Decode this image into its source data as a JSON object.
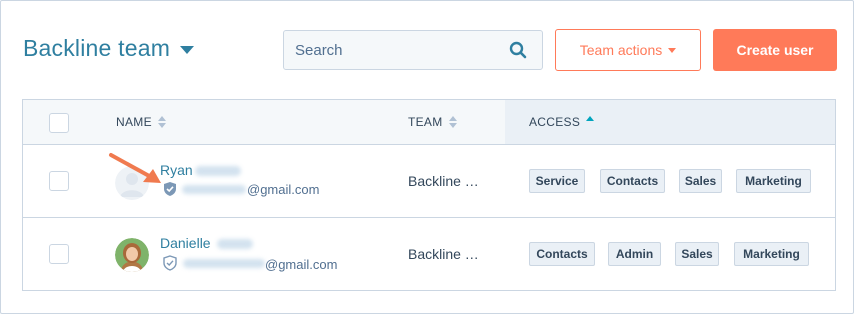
{
  "header": {
    "title": "Backline team",
    "search_placeholder": "Search",
    "team_actions_label": "Team actions",
    "create_user_label": "Create user"
  },
  "columns": {
    "name": "NAME",
    "team": "TEAM",
    "access": "ACCESS"
  },
  "users": [
    {
      "first_name": "Ryan",
      "email_suffix": "@gmail.com",
      "team": "Backline …",
      "access": [
        "Service",
        "Contacts",
        "Sales",
        "Marketing"
      ]
    },
    {
      "first_name": "Danielle",
      "email_suffix": "@gmail.com",
      "team": "Backline …",
      "access": [
        "Contacts",
        "Admin",
        "Sales",
        "Marketing"
      ]
    }
  ],
  "colors": {
    "accent": "#ff7a59",
    "link": "#2f7fa0",
    "border": "#cbd6e2",
    "sort_active": "#00a4bd"
  },
  "icons": {
    "search": "search-icon",
    "shield": "shield-icon",
    "arrow": "pointer-arrow-icon"
  }
}
